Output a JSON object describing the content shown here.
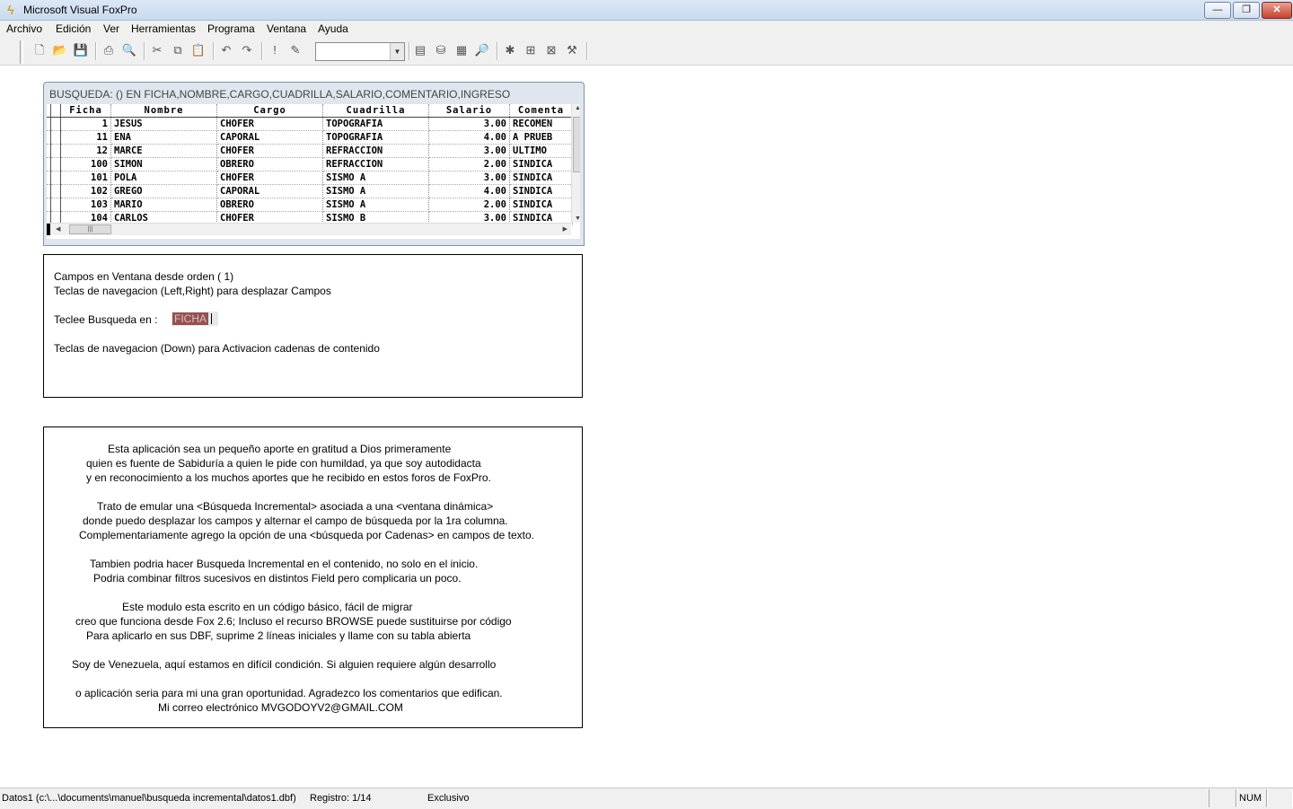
{
  "window": {
    "title": "Microsoft Visual FoxPro",
    "min_glyph": "—",
    "max_glyph": "❐",
    "close_glyph": "✕"
  },
  "menu": [
    "Archivo",
    "Edición",
    "Ver",
    "Herramientas",
    "Programa",
    "Ventana",
    "Ayuda"
  ],
  "toolbar": {
    "icons": [
      "new-file-icon",
      "open-icon",
      "save-icon",
      "print-icon",
      "print-preview-icon",
      "cut-icon",
      "copy-icon",
      "paste-icon",
      "undo-icon",
      "redo-icon",
      "run-icon",
      "modify-icon",
      "combo",
      "data-session-icon",
      "database-icon",
      "form-icon",
      "report-icon",
      "wizard-icon",
      "designer-icon",
      "builder-icon",
      "tools-icon"
    ],
    "combo_value": ""
  },
  "browse": {
    "title": "BUSQUEDA: () EN FICHA,NOMBRE,CARGO,CUADRILLA,SALARIO,COMENTARIO,INGRESO",
    "columns": [
      "Ficha",
      "Nombre",
      "Cargo",
      "Cuadrilla",
      "Salario",
      "Comenta"
    ],
    "rows": [
      [
        "1",
        "JESUS",
        "CHOFER",
        "TOPOGRAFIA",
        "3.00",
        "RECOMEN"
      ],
      [
        "11",
        "ENA",
        "CAPORAL",
        "TOPOGRAFIA",
        "4.00",
        "A PRUEB"
      ],
      [
        "12",
        "MARCE",
        "CHOFER",
        "REFRACCION",
        "3.00",
        "ULTIMO"
      ],
      [
        "100",
        "SIMON",
        "OBRERO",
        "REFRACCION",
        "2.00",
        "SINDICA"
      ],
      [
        "101",
        "POLA",
        "CHOFER",
        "SISMO A",
        "3.00",
        "SINDICA"
      ],
      [
        "102",
        "GREGO",
        "CAPORAL",
        "SISMO A",
        "4.00",
        "SINDICA"
      ],
      [
        "103",
        "MARIO",
        "OBRERO",
        "SISMO A",
        "2.00",
        "SINDICA"
      ],
      [
        "104",
        "CARLOS",
        "CHOFER",
        "SISMO B",
        "3.00",
        "SINDICA"
      ]
    ]
  },
  "search_panel": {
    "line1": "Campos en Ventana desde orden ( 1)",
    "line2": "Teclas de navegacion (Left,Right) para desplazar Campos",
    "prompt": "Teclee Busqueda en :",
    "field": "FICHA",
    "line4": "Teclas de navegacion (Down) para Activacion cadenas de contenido"
  },
  "info_panel": [
    "Esta aplicación sea un pequeño aporte en gratitud a Dios primeramente",
    "quien es fuente de Sabiduría a quien le pide con humildad, ya que soy autodidacta",
    "y en reconocimiento a los muchos aportes que he recibido en estos foros de FoxPro.",
    "Trato de emular una <Búsqueda Incremental> asociada a una <ventana dinámica>",
    "donde puedo desplazar los campos y alternar el campo de búsqueda por la 1ra columna.",
    "Complementariamente agrego la opción de una <búsqueda por Cadenas> en campos de texto.",
    "Tambien podria hacer Busqueda Incremental en el contenido, no solo en el inicio.",
    "Podria combinar filtros sucesivos en distintos Field pero complicaria un poco.",
    "Este modulo esta escrito en un código básico, fácil de migrar",
    "creo que funciona desde Fox 2.6; Incluso el recurso BROWSE puede sustituirse por código",
    "Para aplicarlo en sus DBF, suprime 2 líneas iniciales y llame con su tabla abierta",
    "Soy de Venezuela, aquí estamos en difícil condición. Si alguien requiere algún desarrollo",
    "o aplicación seria para mi una gran oportunidad. Agradezco los comentarios que edifican.",
    "Mi correo electrónico MVGODOYV2@GMAIL.COM"
  ],
  "status": {
    "file": "Datos1 (c:\\...\\documents\\manuel\\busqueda incremental\\datos1.dbf)",
    "record": "Registro: 1/14",
    "mode": "Exclusivo",
    "num": "NUM"
  }
}
